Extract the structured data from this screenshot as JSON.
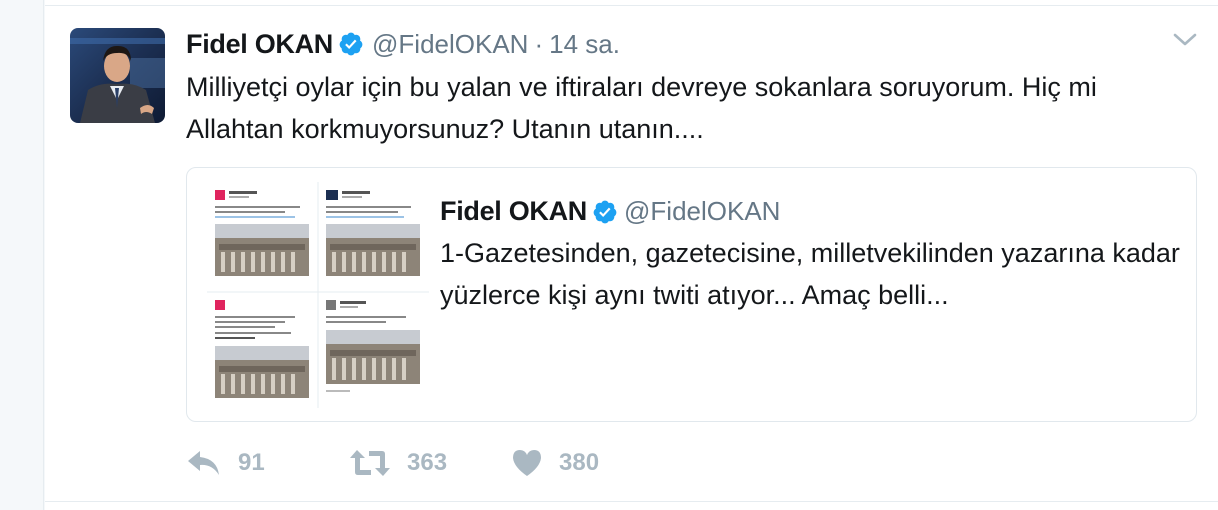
{
  "tweet": {
    "author_name": "Fidel OKAN",
    "author_handle": "@FidelOKAN",
    "separator": "·",
    "time": "14 sa.",
    "text": "Milliyetçi oylar için bu yalan ve iftiraları devreye sokanlara soruyorum. Hiç mi Allahtan korkmuyorsunuz? Utanın utanın...."
  },
  "quote": {
    "author_name": "Fidel OKAN",
    "author_handle": "@FidelOKAN",
    "text": "1-Gazetesinden, gazetecisine, milletvekilinden yazarına kadar yüzlerce kişi aynı twiti atıyor... Amaç belli..."
  },
  "actions": {
    "reply_count": "91",
    "retweet_count": "363",
    "like_count": "380"
  },
  "icons": {
    "verified": "verified-badge-icon",
    "caret": "chevron-down-icon",
    "reply": "reply-icon",
    "retweet": "retweet-icon",
    "like": "heart-icon"
  },
  "colors": {
    "verified_blue": "#1da1f2",
    "muted_gray": "#657786",
    "action_gray": "#aab8c2"
  }
}
